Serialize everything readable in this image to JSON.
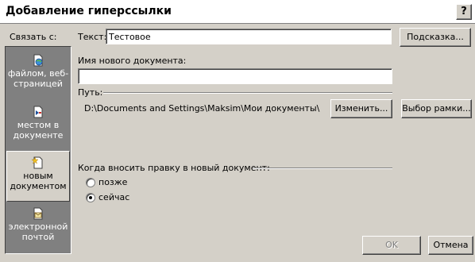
{
  "dialog": {
    "title": "Добавление гиперссылки",
    "help": "?"
  },
  "link_with": {
    "label": "Связать с:",
    "items": [
      {
        "label1": "файлом, веб-",
        "label2": "страницей",
        "icon": "file-web-icon"
      },
      {
        "label1": "местом в",
        "label2": "документе",
        "icon": "place-in-document-icon"
      },
      {
        "label1": "новым",
        "label2": "документом",
        "icon": "new-document-icon",
        "selected": true
      },
      {
        "label1": "электронной",
        "label2": "почтой",
        "icon": "email-icon"
      }
    ]
  },
  "form": {
    "text_label": "Текст:",
    "text_value": "Тестовое",
    "hint_button": "Подсказка...",
    "new_doc_label": "Имя нового документа:",
    "new_doc_value": "",
    "path_label": "Путь:",
    "path_value": "D:\\Documents and Settings\\Maksim\\Мои документы\\",
    "change_button": "Изменить...",
    "frame_button": "Выбор рамки...",
    "edit_when_label": "Когда вносить правку в новый документ:",
    "later_label": "позже",
    "now_label": "сейчас",
    "selected_option": "now"
  },
  "footer": {
    "ok_button": "OK",
    "cancel_button": "Отмена"
  }
}
